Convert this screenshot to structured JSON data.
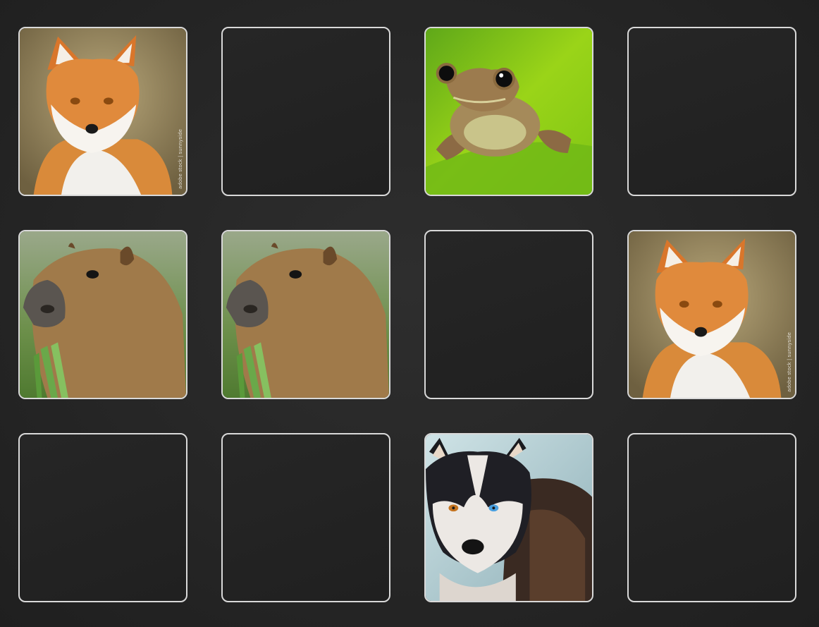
{
  "game": {
    "rows": 3,
    "columns": 4,
    "cards": [
      {
        "state": "face-up",
        "animal": "fox",
        "watermark": "adobe stock | sunnyside"
      },
      {
        "state": "face-down",
        "animal": ""
      },
      {
        "state": "face-up",
        "animal": "frog"
      },
      {
        "state": "face-down",
        "animal": ""
      },
      {
        "state": "face-up",
        "animal": "capybara"
      },
      {
        "state": "face-up",
        "animal": "capybara"
      },
      {
        "state": "face-down",
        "animal": ""
      },
      {
        "state": "face-up",
        "animal": "fox",
        "watermark": "adobe stock | sunnyside"
      },
      {
        "state": "face-down",
        "animal": ""
      },
      {
        "state": "face-down",
        "animal": ""
      },
      {
        "state": "face-up",
        "animal": "husky"
      },
      {
        "state": "face-down",
        "animal": ""
      }
    ]
  },
  "colors": {
    "background": "#262626",
    "card_border": "#d9d9d9",
    "card_back": "#222222"
  }
}
